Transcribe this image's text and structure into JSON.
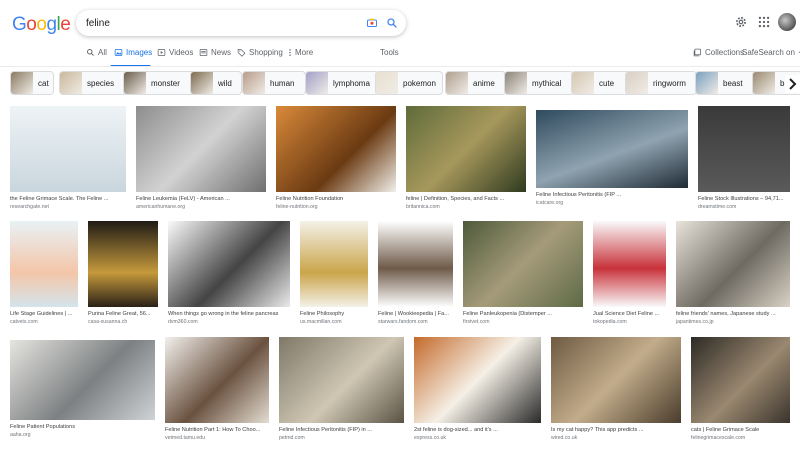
{
  "search": {
    "logo_letters": [
      {
        "ch": "G",
        "color": "#4285F4"
      },
      {
        "ch": "o",
        "color": "#EA4335"
      },
      {
        "ch": "o",
        "color": "#FBBC05"
      },
      {
        "ch": "g",
        "color": "#4285F4"
      },
      {
        "ch": "l",
        "color": "#34A853"
      },
      {
        "ch": "e",
        "color": "#EA4335"
      }
    ],
    "query": "feline"
  },
  "nav": {
    "tabs": [
      "All",
      "Images",
      "Videos",
      "News",
      "Shopping",
      "More"
    ],
    "tools": "Tools",
    "collections": "Collections",
    "safesearch": "SafeSearch on"
  },
  "chips": [
    "cat",
    "species",
    "monster",
    "wild",
    "human",
    "lymphoma",
    "pokemon",
    "anime",
    "mythical",
    "cute",
    "ringworm",
    "beast",
    "b"
  ],
  "results": [
    {
      "title": "the Feline Grimace Scale. The Feline ...",
      "source": "researchgate.net"
    },
    {
      "title": "Feline Leukemia (FeLV) - American ...",
      "source": "americanhumane.org"
    },
    {
      "title": "Feline Nutrition Foundation",
      "source": "feline-nutrition.org"
    },
    {
      "title": "feline | Definition, Species, and Facts ...",
      "source": "britannica.com"
    },
    {
      "title": "Feline Infectious Peritonitis (FIP ...",
      "source": "icatcare.org"
    },
    {
      "title": "Feline Stock Illustrations – 94,71...",
      "source": "dreamstime.com"
    },
    {
      "title": "Life Stage Guidelines | ...",
      "source": "catvets.com"
    },
    {
      "title": "Purina Feline Great, 56...",
      "source": "casa-susanna.ch"
    },
    {
      "title": "When things go wrong in the feline pancreas",
      "source": "dvm360.com"
    },
    {
      "title": "Feline Philosophy",
      "source": "us.macmillan.com"
    },
    {
      "title": "Feline | Wookieepedia | Fa...",
      "source": "starwars.fandom.com"
    },
    {
      "title": "Feline Panleukopenia (Distemper ...",
      "source": "firstvet.com"
    },
    {
      "title": "Jual Science Diet Feline ...",
      "source": "tokopedia.com"
    },
    {
      "title": "feline friends' names, Japanese study ...",
      "source": "japantimes.co.jp"
    },
    {
      "title": "Feline Patient Populations",
      "source": "aaha.org"
    },
    {
      "title": "Feline Nutrition Part 1: How To Choo...",
      "source": "vetmed.tamu.edu"
    },
    {
      "title": "Feline Infectious Peritonitis (FIP) in ...",
      "source": "petmd.com"
    },
    {
      "title": "2st feline is dog-sized... and it's ...",
      "source": "express.co.uk"
    },
    {
      "title": "Is my cat happy? This app predicts ...",
      "source": "wired.co.uk"
    },
    {
      "title": "cats | Feline Grimace Scale",
      "source": "felinegrimacescale.com"
    }
  ],
  "colors": {
    "accent": "#1a73e8",
    "text": "#202124",
    "muted": "#70757a",
    "chip_border": "#dadce0"
  },
  "icons": [
    "camera-icon",
    "search-icon",
    "gear-icon",
    "apps-grid-icon",
    "collections-icon",
    "chevron-right-icon"
  ]
}
